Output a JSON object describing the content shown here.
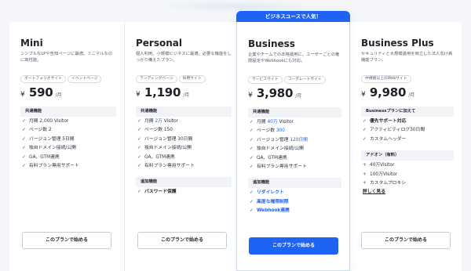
{
  "colors": {
    "accent": "#1f63f5",
    "section_bg": "#f1f3f6",
    "page_bg": "#f4f6f9"
  },
  "plans": [
    {
      "name": "Mini",
      "desc": "シンプルなLPや告知ページに最適。ミニマルなのに高性能。",
      "tags": [
        "ポートフォリオサイト",
        "イベントページ"
      ],
      "currency": "¥",
      "price": "590",
      "per": "/月",
      "section1_title": "共通機能",
      "features": [
        {
          "mark": "✓",
          "text": "月間 2,000 Visitor"
        },
        {
          "mark": "✓",
          "text": "ページ数 2"
        },
        {
          "mark": "✓",
          "text": "バージョン管理 5日間"
        },
        {
          "mark": "✓",
          "text": "独自ドメイン接続/公開"
        },
        {
          "mark": "✓",
          "text": "GA、GTM連携"
        },
        {
          "mark": "✓",
          "text": "有料プラン専用サポート"
        }
      ],
      "cta": "このプランで始める"
    },
    {
      "name": "Personal",
      "desc": "個人利用、小規模ビジネスに最適。必要な機能をしっかり備えたプラン。",
      "tags": [
        "ランディングページ",
        "採用サイト"
      ],
      "currency": "¥",
      "price": "1,190",
      "per": "/月",
      "section1_title": "共通機能",
      "features": [
        {
          "mark": "✓",
          "pre": "月間 ",
          "hl": "2万",
          "post": " Visitor"
        },
        {
          "mark": "✓",
          "text": "ページ数 150"
        },
        {
          "mark": "✓",
          "text": "バージョン管理 30日間"
        },
        {
          "mark": "✓",
          "text": "独自ドメイン接続/公開"
        },
        {
          "mark": "✓",
          "text": "GA、GTM連携"
        },
        {
          "mark": "✓",
          "text": "有料プラン専用サポート"
        }
      ],
      "section2_title": "追加機能",
      "extras": [
        {
          "mark": "✓",
          "text": "パスワード保護"
        }
      ],
      "cta": "このプランで始める"
    },
    {
      "badge": "ビジネスユースで人気！",
      "name": "Business",
      "desc": "企業やチームでの本格運用に。ユーザーごとの権限設定やWebhookにも対応。",
      "tags": [
        "サービスサイト",
        "コーポレートサイト"
      ],
      "currency": "¥",
      "price": "3,980",
      "per": "/月",
      "section1_title": "共通機能",
      "features": [
        {
          "mark": "✓",
          "pre": "月間 ",
          "hl": "40万",
          "post": " Visitor"
        },
        {
          "mark": "✓",
          "pre": "ページ数 ",
          "hl": "300",
          "post": ""
        },
        {
          "mark": "✓",
          "pre": "バージョン管理 ",
          "hl": "120日間",
          "post": ""
        },
        {
          "mark": "✓",
          "text": "独自ドメイン接続/公開"
        },
        {
          "mark": "✓",
          "text": "GA、GTM連携"
        },
        {
          "mark": "✓",
          "text": "有料プラン専用サポート"
        }
      ],
      "section2_title": "追加機能",
      "extras": [
        {
          "mark": "✓",
          "text": "リダイレクト"
        },
        {
          "mark": "✓",
          "text": "高度な権限制限"
        },
        {
          "mark": "✓",
          "text": "Webhook連携"
        }
      ],
      "cta": "このプランで始める"
    },
    {
      "name": "Business Plus",
      "desc": "セキュリティと大規模運用を両立した法人向け高機能プラン。",
      "tags": [
        "中規模以上のWebサイト"
      ],
      "currency": "¥",
      "price": "9,980",
      "per": "/月",
      "section1_title": "Businessプランに加えて",
      "features": [
        {
          "mark": "✓",
          "text": "優先サポート対応"
        },
        {
          "mark": "✓",
          "text": "アクティビティログ30日間"
        },
        {
          "mark": "✓",
          "text": "カスタムヘッダー"
        }
      ],
      "section2_title": "アドオン（有料）",
      "extras": [
        {
          "mark": "+",
          "text": "40万Visitor"
        },
        {
          "mark": "+",
          "text": "100万Visitor"
        },
        {
          "mark": "+",
          "text": "カスタムプロキシ"
        }
      ],
      "more_link": "詳しく見る",
      "cta": "このプランで始める"
    }
  ]
}
